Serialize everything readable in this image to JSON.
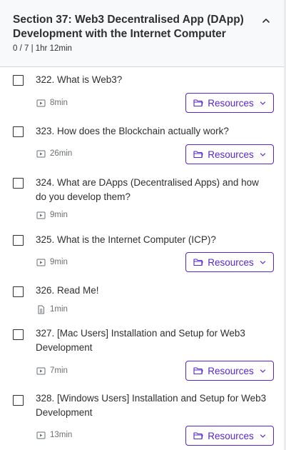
{
  "section": {
    "title": "Section 37: Web3 Decentralised App (DApp) Development with the Internet Computer",
    "progress": "0 / 7 | 1hr 12min"
  },
  "lectures": [
    {
      "title": "322. What is Web3?",
      "duration": "8min",
      "type": "video",
      "resources_label": "Resources"
    },
    {
      "title": "323. How does the Blockchain actually work?",
      "duration": "26min",
      "type": "video",
      "resources_label": "Resources"
    },
    {
      "title": "324. What are DApps (Decentralised Apps) and how do you develop them?",
      "duration": "9min",
      "type": "video"
    },
    {
      "title": "325. What is the Internet Computer (ICP)?",
      "duration": "9min",
      "type": "video",
      "resources_label": "Resources"
    },
    {
      "title": "326. Read Me!",
      "duration": "1min",
      "type": "article"
    },
    {
      "title": "327. [Mac Users] Installation and Setup for Web3 Development",
      "duration": "7min",
      "type": "video",
      "resources_label": "Resources"
    },
    {
      "title": "328. [Windows Users] Installation and Setup for Web3 Development",
      "duration": "13min",
      "type": "video",
      "resources_label": "Resources"
    }
  ],
  "icons": {
    "collapse": "chevron-up-icon",
    "video": "video-play-icon",
    "article": "document-icon",
    "resources": "folder-open-icon",
    "dropdown": "chevron-down-icon"
  },
  "colors": {
    "accent": "#5624d0",
    "header_bg": "#f7f9fa",
    "text": "#2d2f31",
    "muted": "#6a6f73"
  }
}
